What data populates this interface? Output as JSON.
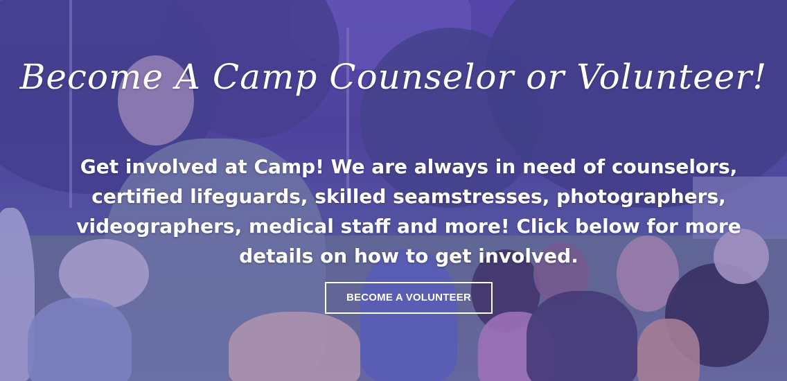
{
  "hero": {
    "title": "Become A Camp Counselor or Volunteer!",
    "description": "Get involved at Camp! We are always in need of counselors, certified lifeguards, skilled seamstresses, photographers, videographers, medical staff and more! Click below for more details on how to get involved.",
    "cta_label": "BECOME A VOLUNTEER"
  },
  "colors": {
    "overlay": "#4e3eaa",
    "text": "#ffffff",
    "button_border": "#ffffff"
  }
}
